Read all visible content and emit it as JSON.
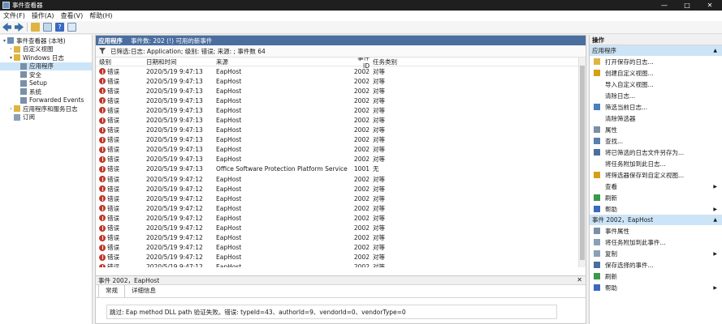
{
  "window": {
    "title": "事件查看器"
  },
  "menu": [
    "文件(F)",
    "操作(A)",
    "查看(V)",
    "帮助(H)"
  ],
  "window_controls": {
    "minimize": "—",
    "maximize": "□",
    "close": "✕"
  },
  "tree": [
    {
      "label": "事件查看器 (本地)",
      "level": 0,
      "arrow": "▾",
      "color": "#6b8fb8"
    },
    {
      "label": "自定义视图",
      "level": 1,
      "arrow": "›",
      "color": "#e0b440"
    },
    {
      "label": "Windows 日志",
      "level": 1,
      "arrow": "▾",
      "color": "#e0b440"
    },
    {
      "label": "应用程序",
      "level": 2,
      "arrow": "",
      "color": "#7a8fa8",
      "selected": true
    },
    {
      "label": "安全",
      "level": 2,
      "arrow": "",
      "color": "#7a8fa8"
    },
    {
      "label": "Setup",
      "level": 2,
      "arrow": "",
      "color": "#7a8fa8"
    },
    {
      "label": "系统",
      "level": 2,
      "arrow": "",
      "color": "#7a8fa8"
    },
    {
      "label": "Forwarded Events",
      "level": 2,
      "arrow": "",
      "color": "#7a8fa8"
    },
    {
      "label": "应用程序和服务日志",
      "level": 1,
      "arrow": "›",
      "color": "#e0b440"
    },
    {
      "label": "订阅",
      "level": 1,
      "arrow": "",
      "color": "#8aa0b8"
    }
  ],
  "center": {
    "log_name": "应用程序",
    "event_count": "事件数: 202 (!) 可用的新事件",
    "filter_text": "已筛选:日志: Application; 级别: 错误; 来源: ; 事件数 64"
  },
  "columns": [
    "级别",
    "日期和时间",
    "来源",
    "事件 ID",
    "任务类别"
  ],
  "rows": [
    [
      "错误",
      "2020/5/19 9:47:13",
      "EapHost",
      "2002",
      "对等"
    ],
    [
      "错误",
      "2020/5/19 9:47:13",
      "EapHost",
      "2002",
      "对等"
    ],
    [
      "错误",
      "2020/5/19 9:47:13",
      "EapHost",
      "2002",
      "对等"
    ],
    [
      "错误",
      "2020/5/19 9:47:13",
      "EapHost",
      "2002",
      "对等"
    ],
    [
      "错误",
      "2020/5/19 9:47:13",
      "EapHost",
      "2002",
      "对等"
    ],
    [
      "错误",
      "2020/5/19 9:47:13",
      "EapHost",
      "2002",
      "对等"
    ],
    [
      "错误",
      "2020/5/19 9:47:13",
      "EapHost",
      "2002",
      "对等"
    ],
    [
      "错误",
      "2020/5/19 9:47:13",
      "EapHost",
      "2002",
      "对等"
    ],
    [
      "错误",
      "2020/5/19 9:47:13",
      "EapHost",
      "2002",
      "对等"
    ],
    [
      "错误",
      "2020/5/19 9:47:13",
      "EapHost",
      "2002",
      "对等"
    ],
    [
      "错误",
      "2020/5/19 9:47:13",
      "Office Software Protection Platform Service",
      "1001",
      "无"
    ],
    [
      "错误",
      "2020/5/19 9:47:12",
      "EapHost",
      "2002",
      "对等"
    ],
    [
      "错误",
      "2020/5/19 9:47:12",
      "EapHost",
      "2002",
      "对等"
    ],
    [
      "错误",
      "2020/5/19 9:47:12",
      "EapHost",
      "2002",
      "对等"
    ],
    [
      "错误",
      "2020/5/19 9:47:12",
      "EapHost",
      "2002",
      "对等"
    ],
    [
      "错误",
      "2020/5/19 9:47:12",
      "EapHost",
      "2002",
      "对等"
    ],
    [
      "错误",
      "2020/5/19 9:47:12",
      "EapHost",
      "2002",
      "对等"
    ],
    [
      "错误",
      "2020/5/19 9:47:12",
      "EapHost",
      "2002",
      "对等"
    ],
    [
      "错误",
      "2020/5/19 9:47:12",
      "EapHost",
      "2002",
      "对等"
    ],
    [
      "错误",
      "2020/5/19 9:47:12",
      "EapHost",
      "2002",
      "对等"
    ],
    [
      "错误",
      "2020/5/19 9:47:12",
      "EapHost",
      "2002",
      "对等"
    ]
  ],
  "detail": {
    "title": "事件 2002，EapHost",
    "close": "✕",
    "tabs": [
      "常规",
      "详细信息"
    ],
    "message": "跳过: Eap method DLL path 验证失败。错误: typeId=43、authorId=9、vendorId=0、vendorType=0"
  },
  "actions": {
    "header": "操作",
    "section1": "应用程序",
    "items1": [
      {
        "label": "打开保存的日志...",
        "icon": "open-folder-icon",
        "color": "#e0b440"
      },
      {
        "label": "创建自定义视图...",
        "icon": "filter-create-icon",
        "color": "#d4a017"
      },
      {
        "label": "导入自定义视图...",
        "icon": "import-icon",
        "color": "transparent"
      },
      {
        "label": "清除日志...",
        "icon": "clear-icon",
        "color": "transparent"
      },
      {
        "label": "筛选当前日志...",
        "icon": "filter-icon",
        "color": "#4a7fc0"
      },
      {
        "label": "清除筛选器",
        "icon": "clear-filter-icon",
        "color": "transparent"
      },
      {
        "label": "属性",
        "icon": "properties-icon",
        "color": "#7a8fa8"
      },
      {
        "label": "查找...",
        "icon": "find-icon",
        "color": "#5a7fb0"
      },
      {
        "label": "将已筛选的日志文件另存为...",
        "icon": "save-icon",
        "color": "#4a6ea0"
      },
      {
        "label": "将任务附加到此日志...",
        "icon": "attach-task-icon",
        "color": "transparent"
      },
      {
        "label": "将筛选器保存到自定义视图...",
        "icon": "save-filter-icon",
        "color": "#d4a017"
      },
      {
        "label": "查看",
        "icon": "view-icon",
        "color": "transparent",
        "sub": true
      },
      {
        "label": "刷新",
        "icon": "refresh-icon",
        "color": "#3a9a4a"
      },
      {
        "label": "帮助",
        "icon": "help-icon",
        "color": "#3a6ac0",
        "sub": true
      }
    ],
    "section2": "事件 2002，EapHost",
    "items2": [
      {
        "label": "事件属性",
        "icon": "event-properties-icon",
        "color": "#7a8fa8"
      },
      {
        "label": "将任务附加到此事件...",
        "icon": "attach-task-icon",
        "color": "#8aa0b8"
      },
      {
        "label": "复制",
        "icon": "copy-icon",
        "color": "#8aa0b8",
        "sub": true
      },
      {
        "label": "保存选择的事件...",
        "icon": "save-icon",
        "color": "#4a6ea0"
      },
      {
        "label": "刷新",
        "icon": "refresh-icon",
        "color": "#3a9a4a"
      },
      {
        "label": "帮助",
        "icon": "help-icon",
        "color": "#3a6ac0",
        "sub": true
      }
    ]
  },
  "colors": {
    "header_blue": "#4a6ea0",
    "selected": "#cce4f7",
    "error_red": "#c0392b"
  }
}
